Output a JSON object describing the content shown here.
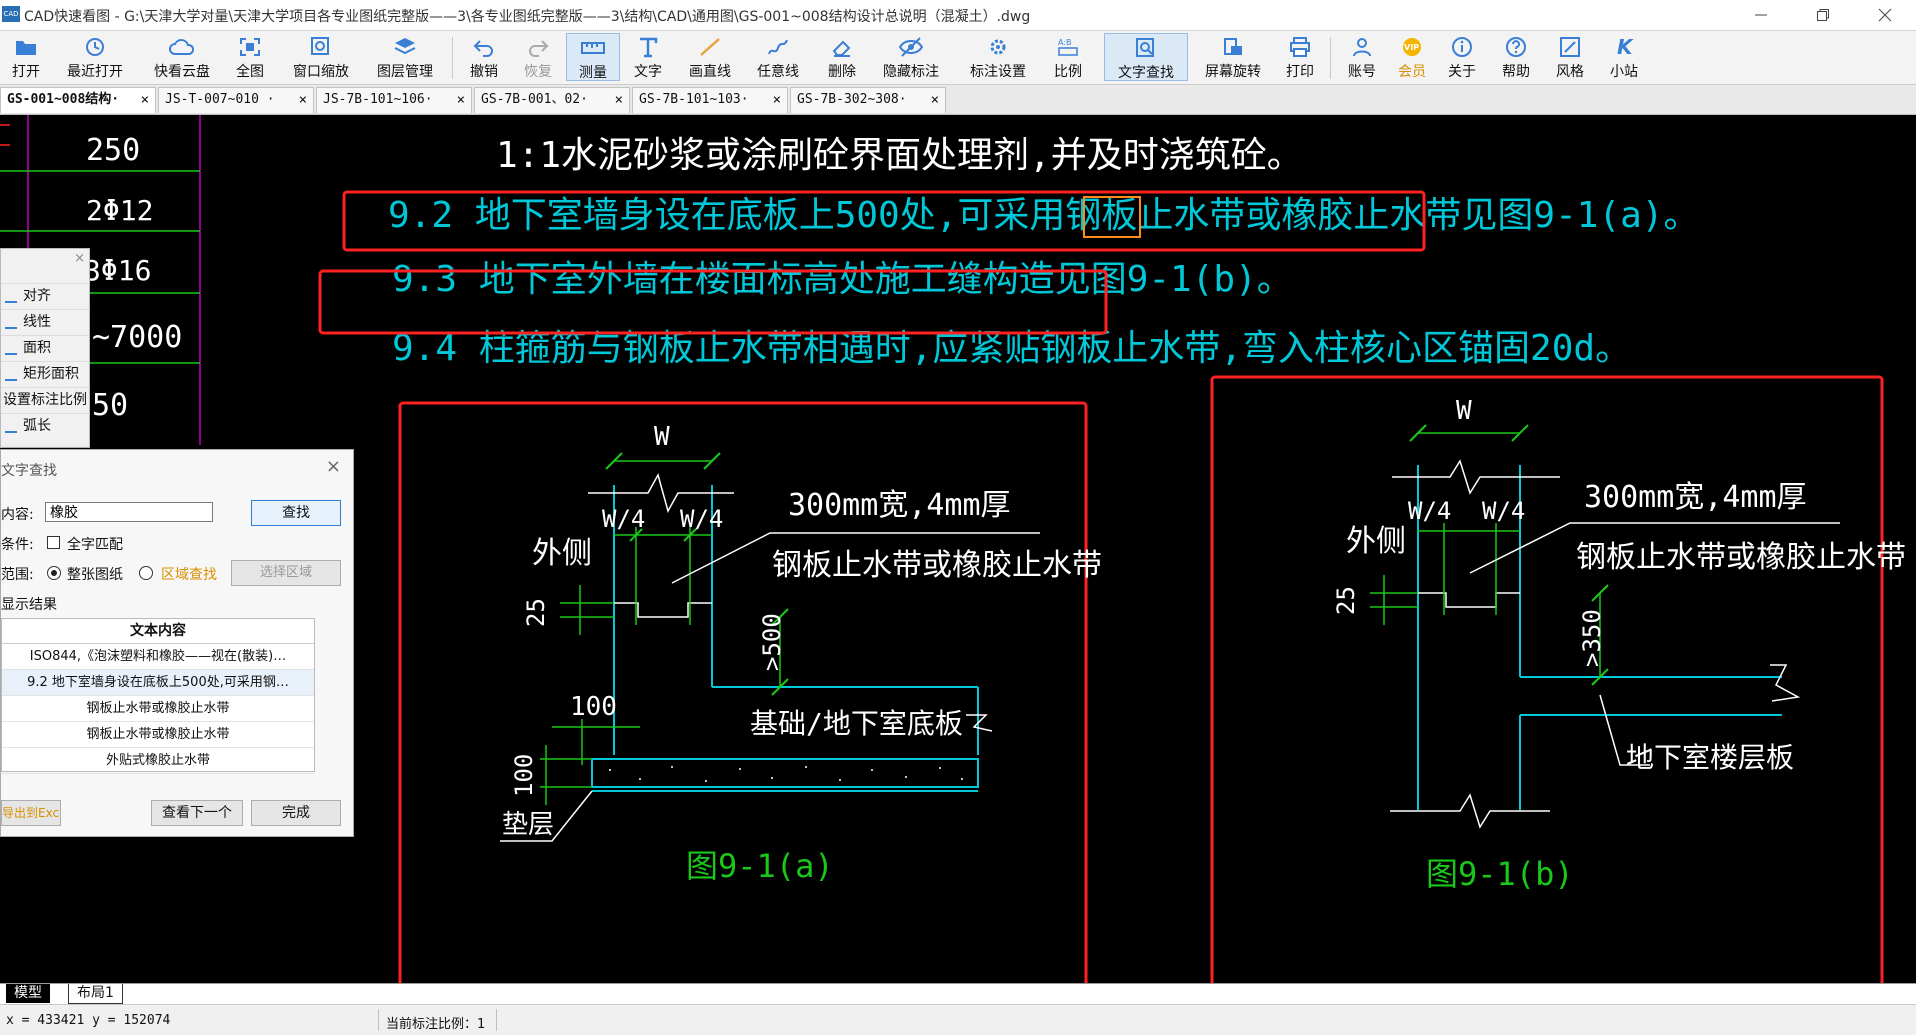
{
  "window": {
    "title": "CAD快速看图 - G:\\天津大学对量\\天津大学项目各专业图纸完整版——3\\各专业图纸完整版——3\\结构\\CAD\\通用图\\GS-001~008结构设计总说明（混凝土）.dwg",
    "logo": "CAD"
  },
  "toolbar": [
    {
      "label": "打开",
      "icon": "folder-open-icon"
    },
    {
      "label": "最近打开",
      "icon": "recent-icon"
    },
    {
      "label": "快看云盘",
      "icon": "cloud-icon"
    },
    {
      "label": "全图",
      "icon": "fit-all-icon"
    },
    {
      "label": "窗口缩放",
      "icon": "zoom-window-icon"
    },
    {
      "label": "图层管理",
      "icon": "layers-icon"
    },
    {
      "label": "撤销",
      "icon": "undo-icon"
    },
    {
      "label": "恢复",
      "icon": "redo-icon"
    },
    {
      "label": "测量",
      "icon": "measure-icon"
    },
    {
      "label": "文字",
      "icon": "text-icon"
    },
    {
      "label": "画直线",
      "icon": "line-icon"
    },
    {
      "label": "任意线",
      "icon": "freehand-icon"
    },
    {
      "label": "删除",
      "icon": "eraser-icon"
    },
    {
      "label": "隐藏标注",
      "icon": "hide-eye-icon"
    },
    {
      "label": "标注设置",
      "icon": "annotation-settings-icon"
    },
    {
      "label": "比例",
      "icon": "scale-icon"
    },
    {
      "label": "文字查找",
      "icon": "text-search-icon"
    },
    {
      "label": "屏幕旋转",
      "icon": "rotate-screen-icon"
    },
    {
      "label": "打印",
      "icon": "printer-icon"
    },
    {
      "label": "账号",
      "icon": "user-icon"
    },
    {
      "label": "会员",
      "icon": "vip-icon"
    },
    {
      "label": "关于",
      "icon": "info-icon"
    },
    {
      "label": "帮助",
      "icon": "help-icon"
    },
    {
      "label": "风格",
      "icon": "style-icon"
    },
    {
      "label": "小站",
      "icon": "k-site-icon"
    }
  ],
  "tabs": [
    {
      "label": "GS-001~008结构·"
    },
    {
      "label": "JS-T-007~010 ·"
    },
    {
      "label": "JS-7B-101~106·"
    },
    {
      "label": "GS-7B-001、02·"
    },
    {
      "label": "GS-7B-101~103·"
    },
    {
      "label": "GS-7B-302~308·"
    }
  ],
  "tab_close": "×",
  "table_fragment": {
    "cells": [
      "250",
      "2Φ12",
      "3Φ16",
      "~7000",
      "50"
    ]
  },
  "drawing": {
    "line1": "1:1水泥砂浆或涂刷砼界面处理剂,并及时浇筑砼。",
    "line92_pre": "9.2  地下室墙身设在底板上500处,可采用钢板止水带或",
    "line92_hit": "橡胶",
    "line92_post": "止水带见图9-1(a)。",
    "line93": "9.3  地下室外墙在楼面标高处施工缝构造见图9-1(b)。",
    "line94": "9.4  柱箍筋与钢板止水带相遇时,应紧贴钢板止水带,弯入柱核心区锚固20d。",
    "a": {
      "W": "W",
      "W4a": "W/4",
      "W4b": "W/4",
      "spec": "300mm宽,4mm厚",
      "band": "钢板止水带或橡胶止水带",
      "outer": "外侧",
      "d25": "25",
      "d500": ">500",
      "d100a": "100",
      "d100b": "100",
      "slab": "基础/地下室底板",
      "cushion": "垫层",
      "caption": "图9-1(a)"
    },
    "b": {
      "W": "W",
      "W4a": "W/4",
      "W4b": "W/4",
      "spec": "300mm宽,4mm厚",
      "band": "钢板止水带或橡胶止水带",
      "outer": "外侧",
      "d25": "25",
      "d350": ">350",
      "slab": "地下室楼层板",
      "caption": "图9-1(b)"
    }
  },
  "measure_menu": {
    "items": [
      "对齐",
      "线性",
      "面积",
      "矩形面积",
      "设置标注比例",
      "弧长"
    ],
    "close": "×"
  },
  "search_dialog": {
    "title": "文字查找",
    "content_label": "内容:",
    "content_value": "橡胶",
    "search_button": "查找",
    "condition_label": "条件:",
    "whole_match": "全字匹配",
    "range_label": "范围:",
    "range_whole": "整张图纸",
    "range_area": "区域查找",
    "select_area": "选择区域",
    "results_label": "显示结果",
    "column_header": "文本内容",
    "results": [
      "ISO844,《泡沫塑料和橡胶——视在(散装)…",
      "9.2 地下室墙身设在底板上500处,可采用钢…",
      "钢板止水带或橡胶止水带",
      "钢板止水带或橡胶止水带",
      "外贴式橡胶止水带"
    ],
    "export_button": "导出到Excel",
    "next_button": "查看下一个",
    "done_button": "完成",
    "close": "×"
  },
  "layout_tabs": [
    "模型",
    "布局1"
  ],
  "status": {
    "coords": "x = 433421  y = 152074",
    "scale": "当前标注比例：1"
  },
  "colors": {
    "cyan": "#00c8d8",
    "green": "#19c819",
    "white": "#ffffff",
    "red": "#ff2222",
    "magenta": "#c000c0",
    "orange": "#ff8c1a"
  }
}
